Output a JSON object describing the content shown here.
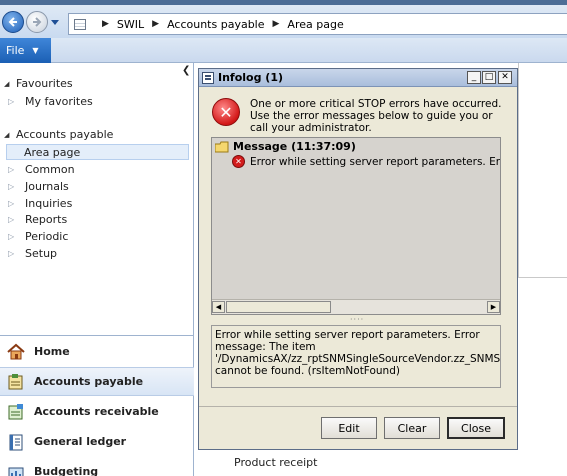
{
  "addressbar": {
    "company": "SWIL",
    "module": "Accounts payable",
    "page": "Area page"
  },
  "filemenu": {
    "label": "File"
  },
  "navpane": {
    "favourites_header": "Favourites",
    "my_favorites": "My favorites",
    "module_header": "Accounts payable",
    "items": [
      "Area page",
      "Common",
      "Journals",
      "Inquiries",
      "Reports",
      "Periodic",
      "Setup"
    ],
    "selected_item": "Area page"
  },
  "modules": [
    {
      "label": "Home",
      "icon": "home-icon"
    },
    {
      "label": "Accounts payable",
      "icon": "accounts-payable-icon",
      "selected": true
    },
    {
      "label": "Accounts receivable",
      "icon": "accounts-receivable-icon"
    },
    {
      "label": "General ledger",
      "icon": "general-ledger-icon"
    },
    {
      "label": "Budgeting",
      "icon": "budgeting-icon"
    }
  ],
  "content": {
    "product_receipt": "Product receipt"
  },
  "infolog": {
    "title": "Infolog (1)",
    "header_message": "One or more critical STOP errors have occurred. Use the error messages below to guide you or call your administrator.",
    "tree_message": "Message (11:37:09)",
    "tree_error": "Error while setting server report parameters. Error message:",
    "detail": "Error while setting server report parameters. Error message: The item '/DynamicsAX/zz_rptSNMSingleSourceVendor.zz_SNMSingleSourceReport' cannot be found. (rsItemNotFound)",
    "buttons": {
      "edit": "Edit",
      "clear": "Clear",
      "close": "Close"
    }
  },
  "colors": {
    "accent": "#1b5fb4",
    "error": "#d31818",
    "dialog_bg": "#ece9d8"
  }
}
